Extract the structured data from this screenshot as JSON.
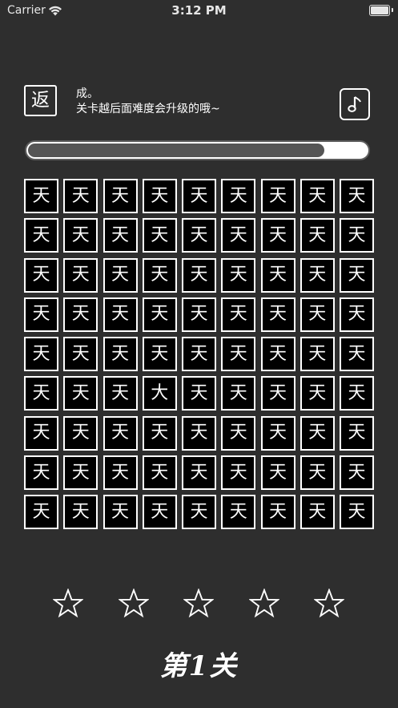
{
  "status_bar": {
    "carrier": "Carrier",
    "time": "3:12 PM"
  },
  "header": {
    "back_label": "返",
    "hint_line1": "成。",
    "hint_line2": "关卡越后面难度会升级的哦~",
    "music_icon": "music-note-icon"
  },
  "progress": {
    "fraction": 0.875
  },
  "grid": {
    "rows": 9,
    "cols": 9,
    "cells": [
      "天",
      "天",
      "天",
      "天",
      "天",
      "天",
      "天",
      "天",
      "天",
      "天",
      "天",
      "天",
      "天",
      "天",
      "天",
      "天",
      "天",
      "天",
      "天",
      "天",
      "天",
      "天",
      "天",
      "天",
      "天",
      "天",
      "天",
      "天",
      "天",
      "天",
      "天",
      "天",
      "天",
      "天",
      "天",
      "天",
      "天",
      "天",
      "天",
      "天",
      "天",
      "天",
      "天",
      "天",
      "天",
      "天",
      "天",
      "天",
      "大",
      "天",
      "天",
      "天",
      "天",
      "天",
      "天",
      "天",
      "天",
      "天",
      "天",
      "天",
      "天",
      "天",
      "天",
      "天",
      "天",
      "天",
      "天",
      "天",
      "天",
      "天",
      "天",
      "天",
      "天",
      "天",
      "天",
      "天",
      "天",
      "天",
      "天",
      "天",
      "天"
    ]
  },
  "stars": {
    "total": 5,
    "filled": 0
  },
  "level": {
    "label": "第1关"
  },
  "colors": {
    "background": "#2e2e2e",
    "cell_bg": "#000000",
    "foreground": "#ffffff",
    "progress_fill": "#555555"
  }
}
